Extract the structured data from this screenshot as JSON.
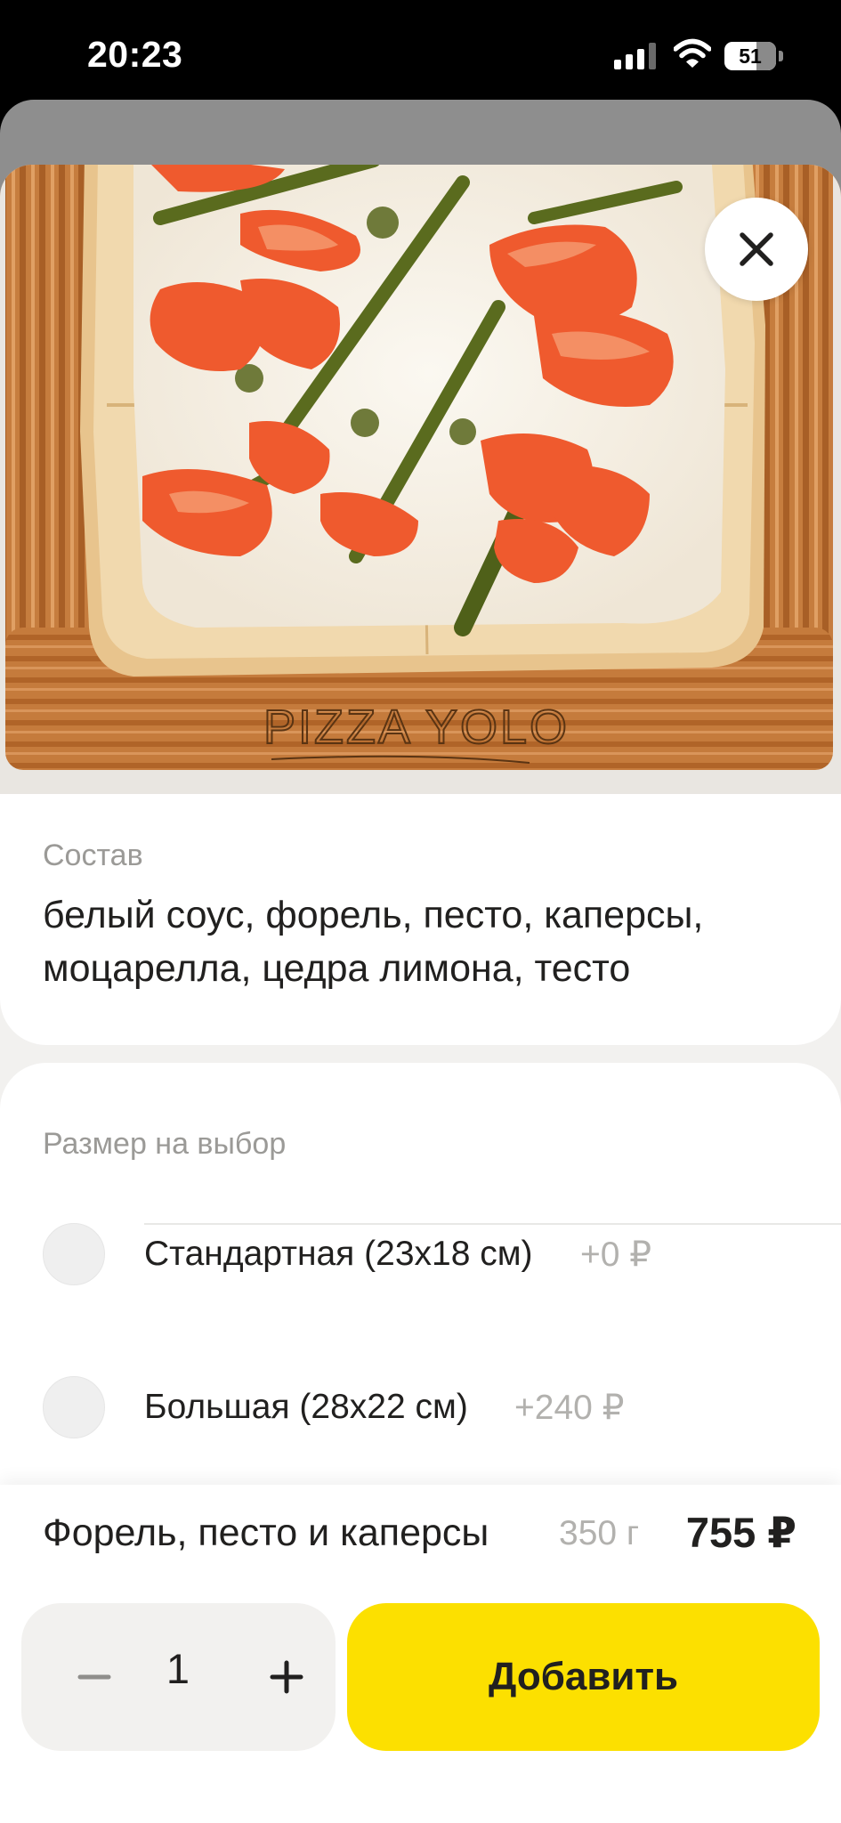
{
  "status_bar": {
    "time": "20:23",
    "battery": "51"
  },
  "product": {
    "composition_label": "Состав",
    "composition": "белый соус, форель, песто, каперсы, моцарелла, цедра лимона, тесто",
    "board_engraving": "PIZZA YOLO",
    "size_label": "Размер на выбор",
    "sizes": [
      {
        "label": "Стандартная (23х18 см)",
        "price": "+0 ₽",
        "selected": false
      },
      {
        "label": "Большая (28х22 см)",
        "price": "+240 ₽",
        "selected": false
      }
    ],
    "name": "Форель, песто и каперсы",
    "weight": "350 г",
    "price": "755 ₽"
  },
  "cart": {
    "quantity": "1",
    "add_label": "Добавить"
  },
  "icons": {
    "close": "close-icon",
    "minus": "minus-icon",
    "plus": "plus-icon",
    "signal": "cellular-signal-icon",
    "wifi": "wifi-icon",
    "battery": "battery-icon"
  },
  "colors": {
    "accent": "#fce000",
    "board": "#c27a3c",
    "muted_text": "#9b9a97"
  }
}
